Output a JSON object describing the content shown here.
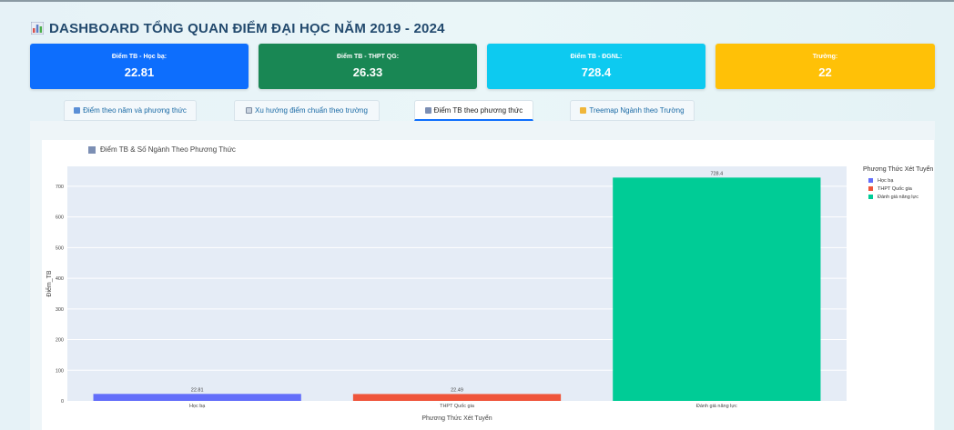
{
  "header": {
    "title": "DASHBOARD TỔNG QUAN ĐIỂM ĐẠI HỌC NĂM 2019 - 2024",
    "title_icon": "bar-chart-icon"
  },
  "cards": [
    {
      "label": "Điểm TB - Học bạ:",
      "value": "22.81",
      "color": "#0d6efd"
    },
    {
      "label": "Điểm TB - THPT QG:",
      "value": "26.33",
      "color": "#198754"
    },
    {
      "label": "Điểm TB - ĐGNL:",
      "value": "728.4",
      "color": "#0dcaf0"
    },
    {
      "label": "Trường:",
      "value": "22",
      "color": "#ffc107"
    }
  ],
  "tabs": [
    {
      "label": "Điểm theo năm và phương thức",
      "icon": "table-icon",
      "active": false
    },
    {
      "label": "Xu hướng điểm chuẩn theo trường",
      "icon": "trend-chart-icon",
      "active": false
    },
    {
      "label": "Điểm TB theo phương thức",
      "icon": "bar-chart-icon",
      "active": true
    },
    {
      "label": "Treemap Ngành theo Trường",
      "icon": "folder-icon",
      "active": false
    }
  ],
  "chart_title": "Điểm TB & Số Ngành Theo Phương Thức",
  "chart_data": {
    "type": "bar",
    "title": "Điểm TB & Số Ngành Theo Phương Thức",
    "categories": [
      "Học bạ",
      "THPT Quốc gia",
      "Đánh giá năng lực"
    ],
    "values": [
      22.81,
      22.49,
      728.4
    ],
    "data_labels": [
      "22.81",
      "22.49",
      "728.4"
    ],
    "colors": [
      "#636efa",
      "#ef553b",
      "#00cc96"
    ],
    "xlabel": "Phương Thức Xét Tuyển",
    "ylabel": "Điểm_TB",
    "ylim": [
      0,
      765
    ],
    "yticks": [
      0,
      100,
      200,
      300,
      400,
      500,
      600,
      700
    ],
    "grid": true,
    "legend": {
      "title": "Phương Thức Xét Tuyển",
      "position": "top-right",
      "items": [
        "Học bạ",
        "THPT Quốc gia",
        "Đánh giá năng lực"
      ]
    }
  }
}
